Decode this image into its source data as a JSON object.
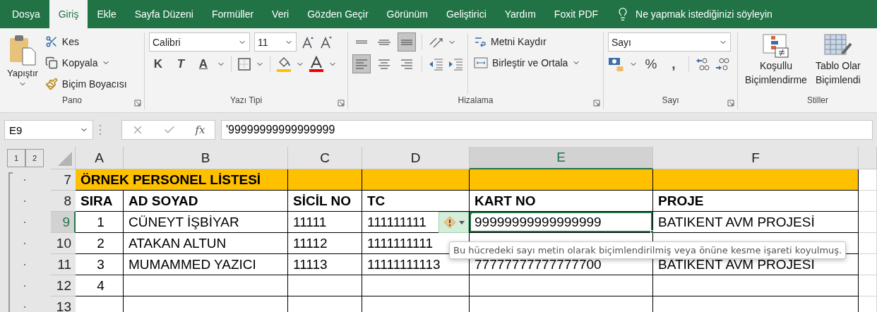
{
  "tabs": [
    {
      "label": "Dosya",
      "selected": false
    },
    {
      "label": "Giriş",
      "selected": true
    },
    {
      "label": "Ekle",
      "selected": false
    },
    {
      "label": "Sayfa Düzeni",
      "selected": false
    },
    {
      "label": "Formüller",
      "selected": false
    },
    {
      "label": "Veri",
      "selected": false
    },
    {
      "label": "Gözden Geçir",
      "selected": false
    },
    {
      "label": "Görünüm",
      "selected": false
    },
    {
      "label": "Geliştirici",
      "selected": false
    },
    {
      "label": "Yardım",
      "selected": false
    },
    {
      "label": "Foxit PDF",
      "selected": false
    }
  ],
  "tell_me": "Ne yapmak istediğinizi söyleyin",
  "clipboard": {
    "paste": "Yapıştır",
    "cut": "Kes",
    "copy": "Kopyala",
    "format_painter": "Biçim Boyacısı",
    "label": "Pano"
  },
  "font": {
    "name": "Calibri",
    "size": "11",
    "bold": "K",
    "italic": "T",
    "underline": "A",
    "label": "Yazı Tipi"
  },
  "alignment": {
    "vertical": [
      {
        "kind": "top",
        "selected": false
      },
      {
        "kind": "middle",
        "selected": false
      },
      {
        "kind": "bottom",
        "selected": true
      }
    ],
    "horizontal": [
      {
        "kind": "left",
        "selected": true
      },
      {
        "kind": "center",
        "selected": false
      },
      {
        "kind": "right",
        "selected": false
      }
    ],
    "wrap": "Metni Kaydır",
    "merge": "Birleştir ve Ortala",
    "label": "Hizalama"
  },
  "number": {
    "format": "Sayı",
    "percent": "%",
    "comma": ",",
    "label": "Sayı"
  },
  "styles": {
    "conditional": [
      "Koşullu",
      "Biçimlendirme"
    ],
    "table": [
      "Tablo Olar",
      "Biçimlendi"
    ],
    "label": "Stiller"
  },
  "formula_bar": {
    "name_box": "E9",
    "function_label": "fx",
    "formula": "'99999999999999999"
  },
  "outline_levels": [
    "1",
    "2"
  ],
  "columns": [
    {
      "label": "A",
      "selected": false
    },
    {
      "label": "B",
      "selected": false
    },
    {
      "label": "C",
      "selected": false
    },
    {
      "label": "D",
      "selected": false
    },
    {
      "label": "E",
      "selected": true
    },
    {
      "label": "F",
      "selected": false
    }
  ],
  "rows": [
    {
      "number": "7",
      "kind": "title",
      "selected": false,
      "cells": [
        "ÖRNEK PERSONEL LİSTESİ"
      ]
    },
    {
      "number": "8",
      "kind": "header",
      "selected": false,
      "cells": [
        "SIRA",
        "AD SOYAD",
        "SİCİL NO",
        "TC",
        "KART NO",
        "PROJE"
      ]
    },
    {
      "number": "9",
      "kind": "data",
      "selected": true,
      "cells": [
        "1",
        "CÜNEYT İŞBİYAR",
        "11111",
        "111111111",
        "99999999999999999",
        "BATIKENT AVM PROJESİ"
      ]
    },
    {
      "number": "10",
      "kind": "data",
      "selected": false,
      "cells": [
        "2",
        "ATAKAN ALTUN",
        "11112",
        "1111111111"
      ]
    },
    {
      "number": "11",
      "kind": "data",
      "selected": false,
      "cells": [
        "3",
        "MUMAMMED YAZICI",
        "11113",
        "11111111113",
        "77777777777777700",
        "BATIKENT AVM PROJESİ"
      ]
    },
    {
      "number": "12",
      "kind": "data",
      "selected": false,
      "cells": [
        "4"
      ]
    },
    {
      "number": "13",
      "kind": "data",
      "selected": false,
      "cells": []
    }
  ],
  "warning": {
    "tooltip": "Bu hücredeki sayı metin olarak biçimlendirilmiş veya önüne kesme işareti koyulmuş."
  }
}
